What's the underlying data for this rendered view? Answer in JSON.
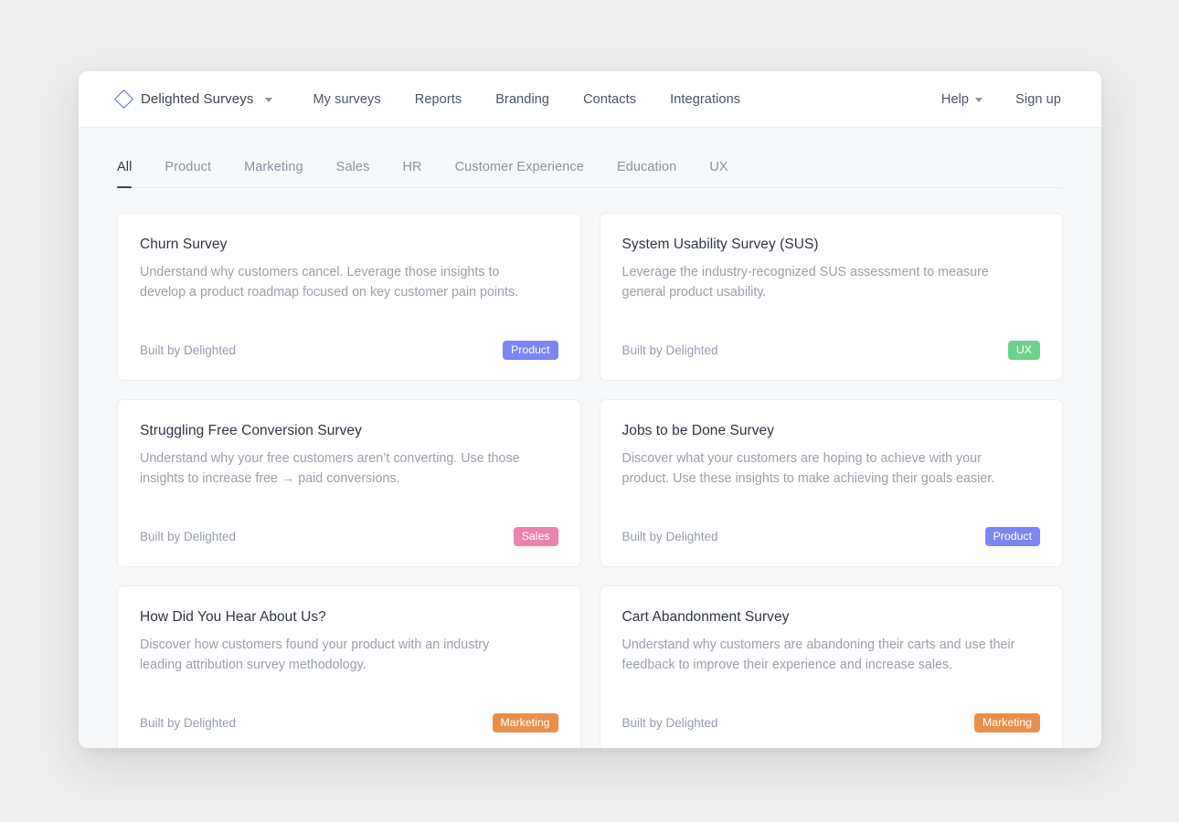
{
  "header": {
    "brand": {
      "name": "Delighted Surveys",
      "logo_icon": "diamond-logo-icon",
      "caret_icon": "chevron-down-icon",
      "logo_color": "#4e63d8"
    },
    "nav": [
      {
        "label": "My surveys"
      },
      {
        "label": "Reports"
      },
      {
        "label": "Branding"
      },
      {
        "label": "Contacts"
      },
      {
        "label": "Integrations"
      }
    ],
    "right_nav": [
      {
        "label": "Help",
        "has_caret": true
      },
      {
        "label": "Sign up",
        "has_caret": false
      }
    ]
  },
  "tabs": [
    {
      "label": "All",
      "active": true
    },
    {
      "label": "Product",
      "active": false
    },
    {
      "label": "Marketing",
      "active": false
    },
    {
      "label": "Sales",
      "active": false
    },
    {
      "label": "HR",
      "active": false
    },
    {
      "label": "Customer Experience",
      "active": false
    },
    {
      "label": "Education",
      "active": false
    },
    {
      "label": "UX",
      "active": false
    }
  ],
  "badge_colors": {
    "Product": "#7b86f2",
    "UX": "#6dd28c",
    "Sales": "#ee82b0",
    "Marketing": "#e8904b"
  },
  "cards": [
    {
      "title": "Churn Survey",
      "description": "Understand why customers cancel. Leverage those insights to develop a product roadmap focused on key customer pain points.",
      "built_by": "Built by Delighted",
      "badge": "Product"
    },
    {
      "title": "System Usability Survey (SUS)",
      "description": "Leverage the industry-recognized SUS assessment to measure general product usability.",
      "built_by": "Built by Delighted",
      "badge": "UX"
    },
    {
      "title": "Struggling Free Conversion Survey",
      "description": "Understand why your free customers aren’t converting. Use those insights to increase free → paid conversions.",
      "built_by": "Built by Delighted",
      "badge": "Sales"
    },
    {
      "title": "Jobs to be Done Survey",
      "description": "Discover what your customers are hoping to achieve with your product. Use these insights to make achieving their goals easier.",
      "built_by": "Built by Delighted",
      "badge": "Product"
    },
    {
      "title": "How Did You Hear About Us?",
      "description": "Discover how customers found your product with an industry leading attribution survey methodology.",
      "built_by": "Built by Delighted",
      "badge": "Marketing"
    },
    {
      "title": "Cart Abandonment Survey",
      "description": "Understand why customers are abandoning their carts and use their feedback to improve their experience and increase sales.",
      "built_by": "Built by Delighted",
      "badge": "Marketing"
    }
  ]
}
